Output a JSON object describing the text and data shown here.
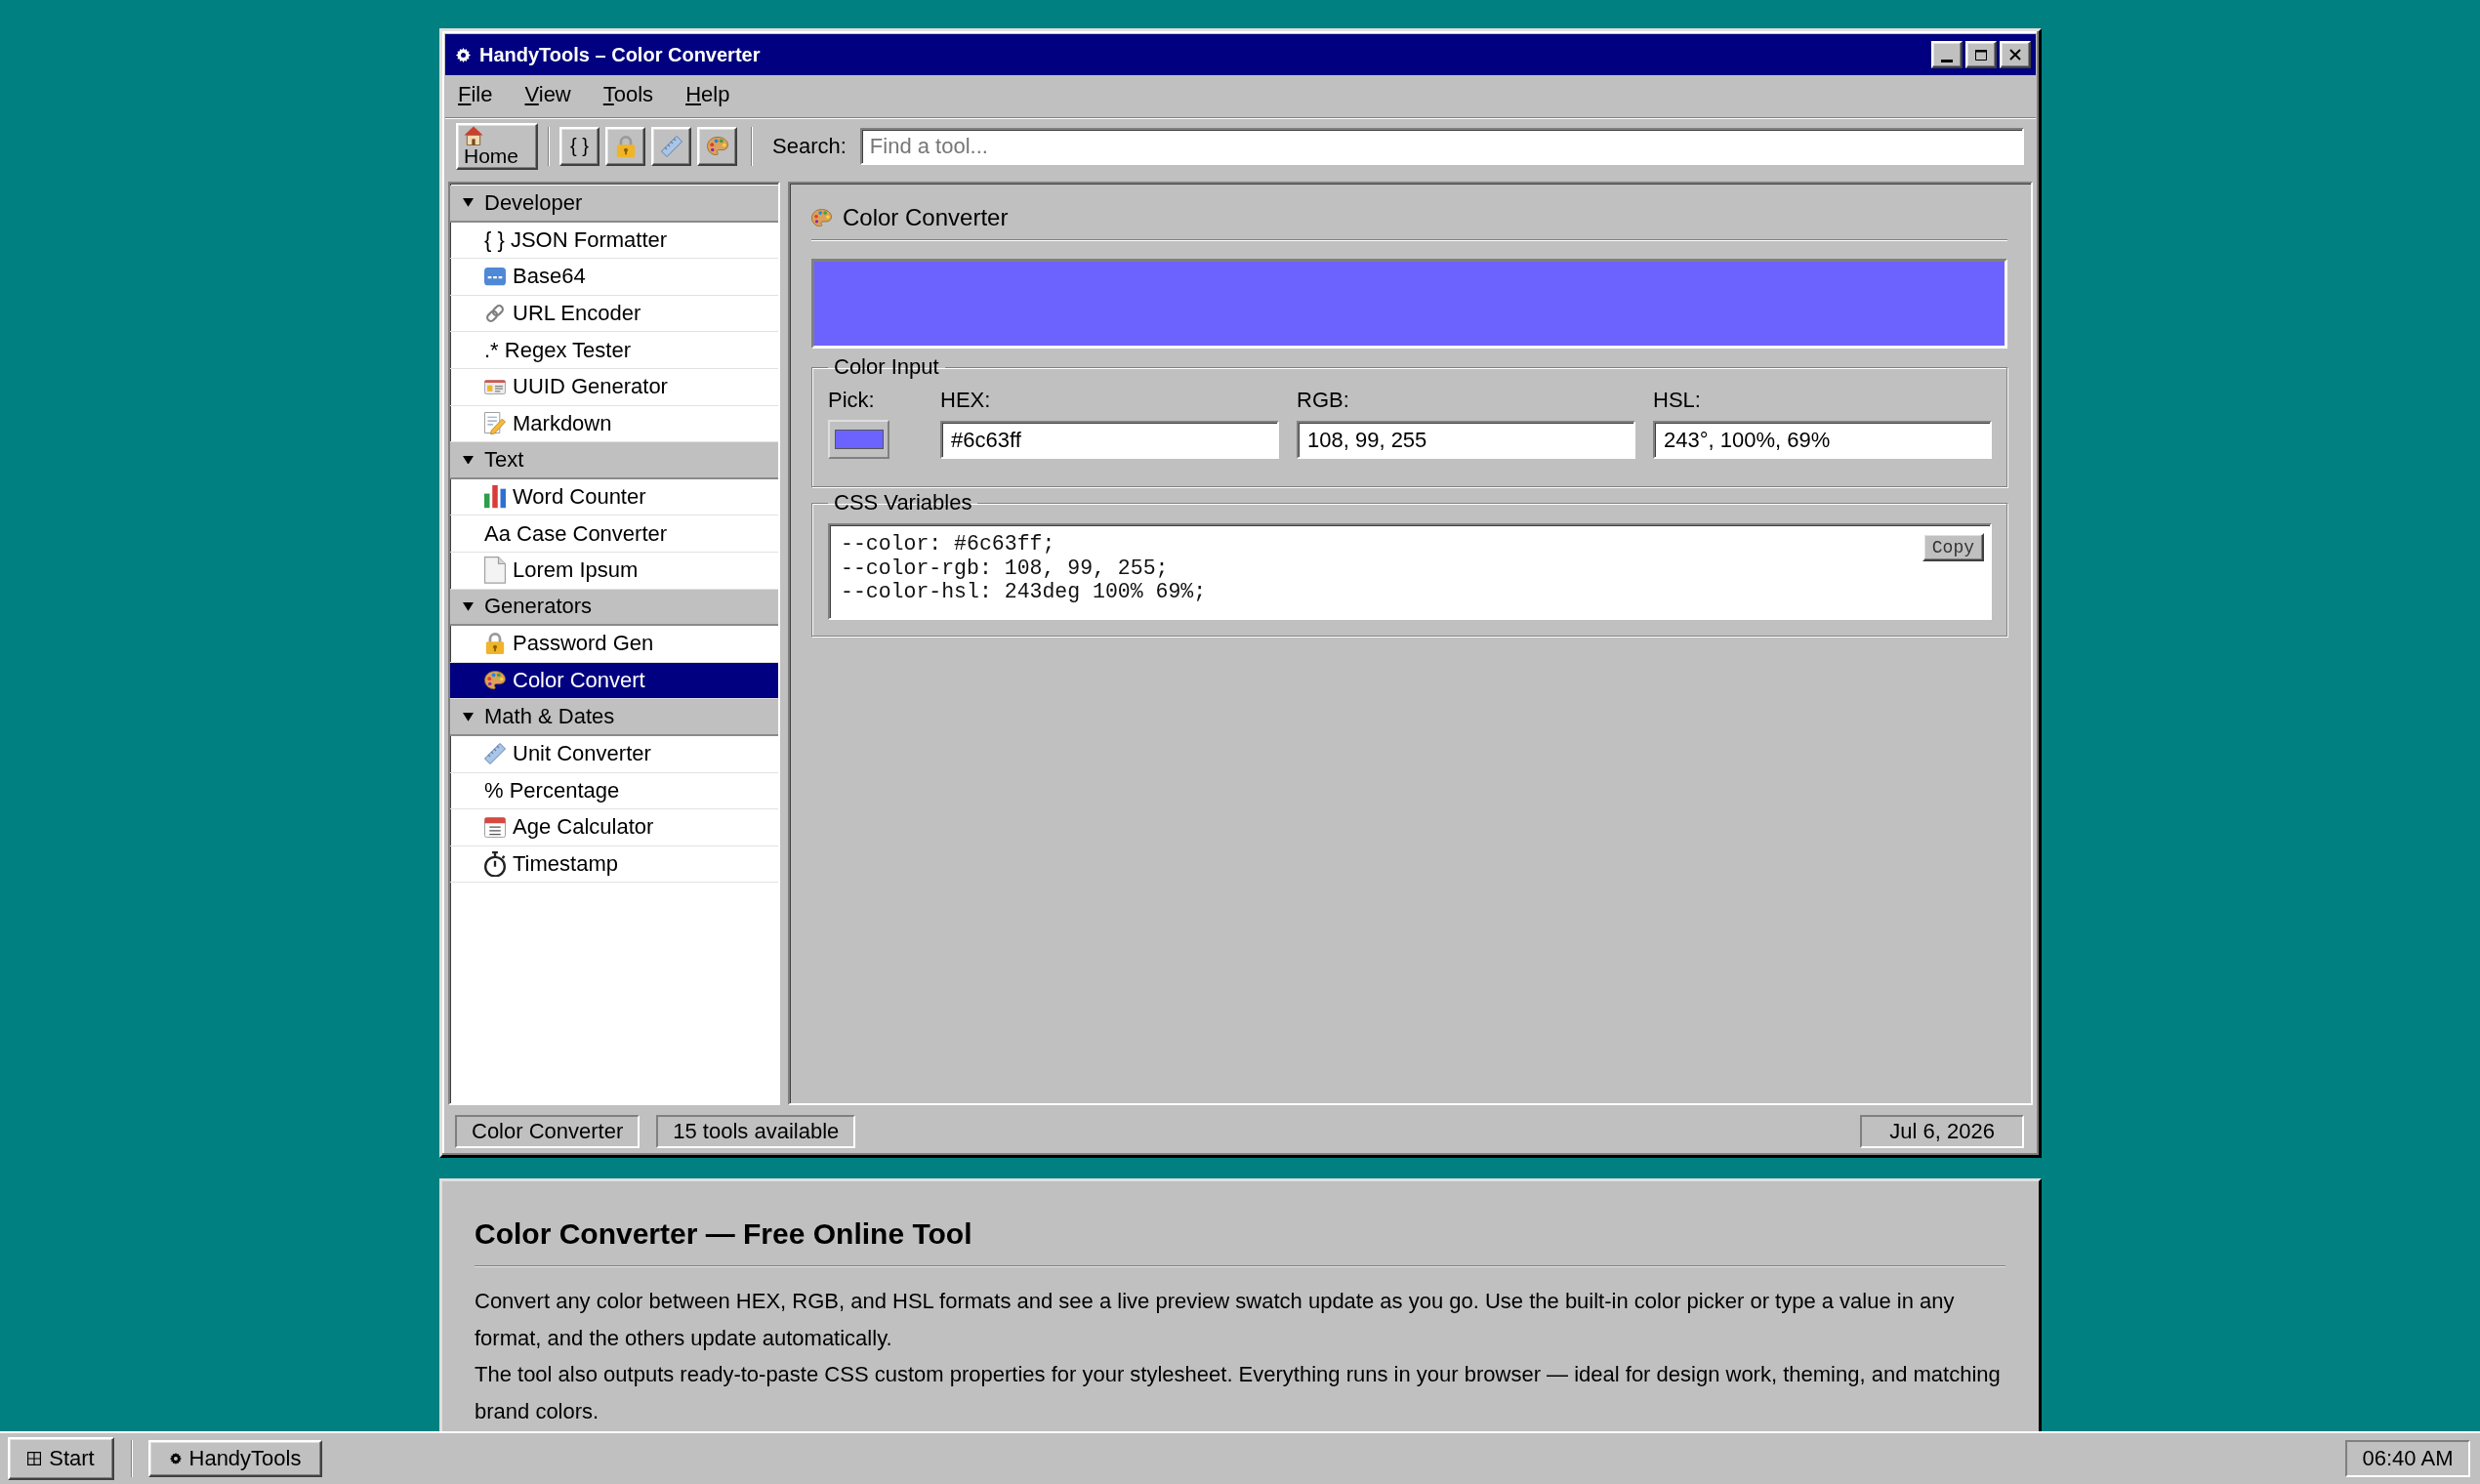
{
  "window": {
    "title": "HandyTools – Color Converter"
  },
  "menu": [
    "File",
    "View",
    "Tools",
    "Help"
  ],
  "toolbar": {
    "home": {
      "label": "Home"
    },
    "buttons": [
      {
        "kind": "text",
        "label": "{ }"
      },
      {
        "kind": "icon"
      },
      {
        "kind": "icon"
      },
      {
        "kind": "icon"
      }
    ],
    "search": {
      "label": "Search:",
      "placeholder": "Find a tool..."
    }
  },
  "sidebar": {
    "groups": [
      {
        "label": "Developer",
        "expanded": true,
        "items": [
          {
            "kind": "text",
            "label": "{ } JSON Formatter",
            "selected": false
          },
          {
            "kind": "icon",
            "label": "Base64",
            "selected": false
          },
          {
            "kind": "icon",
            "label": "URL Encoder",
            "selected": false
          },
          {
            "kind": "text",
            "label": ".* Regex Tester",
            "selected": false
          },
          {
            "kind": "icon",
            "label": "UUID Generator",
            "selected": false
          },
          {
            "kind": "icon",
            "label": "Markdown",
            "selected": false
          }
        ]
      },
      {
        "label": "Text",
        "expanded": true,
        "items": [
          {
            "kind": "icon",
            "label": "Word Counter",
            "selected": false
          },
          {
            "kind": "text",
            "label": "Aa Case Converter",
            "selected": false
          },
          {
            "kind": "icon",
            "label": "Lorem Ipsum",
            "selected": false
          }
        ]
      },
      {
        "label": "Generators",
        "expanded": true,
        "items": [
          {
            "kind": "icon",
            "label": "Password Gen",
            "selected": false
          },
          {
            "kind": "icon",
            "label": "Color Convert",
            "selected": true
          }
        ]
      },
      {
        "label": "Math & Dates",
        "expanded": true,
        "items": [
          {
            "kind": "icon",
            "label": "Unit Converter",
            "selected": false
          },
          {
            "kind": "text",
            "label": "% Percentage",
            "selected": false
          },
          {
            "kind": "icon",
            "label": "Age Calculator",
            "selected": false
          },
          {
            "kind": "icon",
            "label": "Timestamp",
            "selected": false
          }
        ]
      }
    ]
  },
  "panel": {
    "title": "Color Converter",
    "preview": {
      "color": "#6c63ff"
    },
    "color_input": {
      "legend": "Color Input",
      "pick": {
        "label": "Pick:",
        "color": "#6c63ff"
      },
      "fields": [
        {
          "label": "HEX:",
          "value": "#6c63ff"
        },
        {
          "label": "RGB:",
          "value": "108, 99, 255"
        },
        {
          "label": "HSL:",
          "value": "243°, 100%, 69%"
        }
      ]
    },
    "css_variables": {
      "legend": "CSS Variables",
      "lines": [
        "--color: #6c63ff;",
        "--color-rgb: 108, 99, 255;",
        "--color-hsl: 243deg 100% 69%;"
      ],
      "copy_button": "Copy"
    }
  },
  "status_bar": {
    "left": [
      "Color Converter",
      "15 tools available"
    ],
    "right": "Jul 6, 2026"
  },
  "article": {
    "heading": "Color Converter — Free Online Tool",
    "paragraphs": [
      "Convert any color between HEX, RGB, and HSL formats and see a live preview swatch update as you go. Use the built-in color picker or type a value in any format, and the others update automatically.",
      "The tool also outputs ready-to-paste CSS custom properties for your stylesheet. Everything runs in your browser — ideal for design work, theming, and matching brand colors."
    ]
  },
  "taskbar": {
    "start": "Start",
    "tasks": [
      "HandyTools"
    ],
    "clock": "06:40 AM"
  }
}
